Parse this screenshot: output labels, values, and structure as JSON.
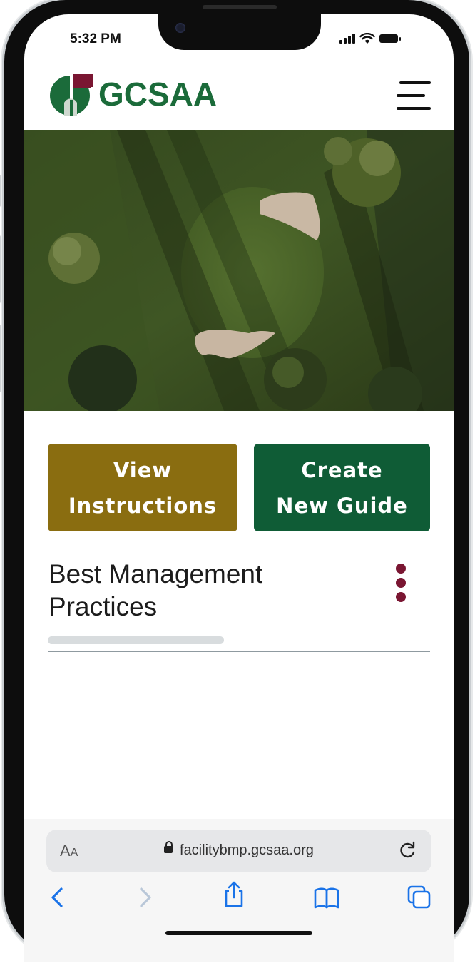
{
  "status_bar": {
    "time": "5:32 PM"
  },
  "header": {
    "logo_text": "GCSAA",
    "menu_icon": "hamburger-menu-icon"
  },
  "actions": {
    "view_line1": "View",
    "view_line2": "Instructions",
    "create_line1": "Create",
    "create_line2": "New Guide"
  },
  "section": {
    "title_line1": "Best Management",
    "title_line2": "Practices",
    "menu_icon": "kebab-menu-icon",
    "progress": 0
  },
  "browser": {
    "text_size_label_big": "A",
    "text_size_label_small": "A",
    "url": "facilitybmp.gcsaa.org"
  },
  "colors": {
    "brand_green": "#1b6b3a",
    "gold_button": "#8a6d10",
    "green_button": "#0f5c36",
    "maroon_accent": "#7a1632",
    "ios_blue": "#1a73e8"
  }
}
